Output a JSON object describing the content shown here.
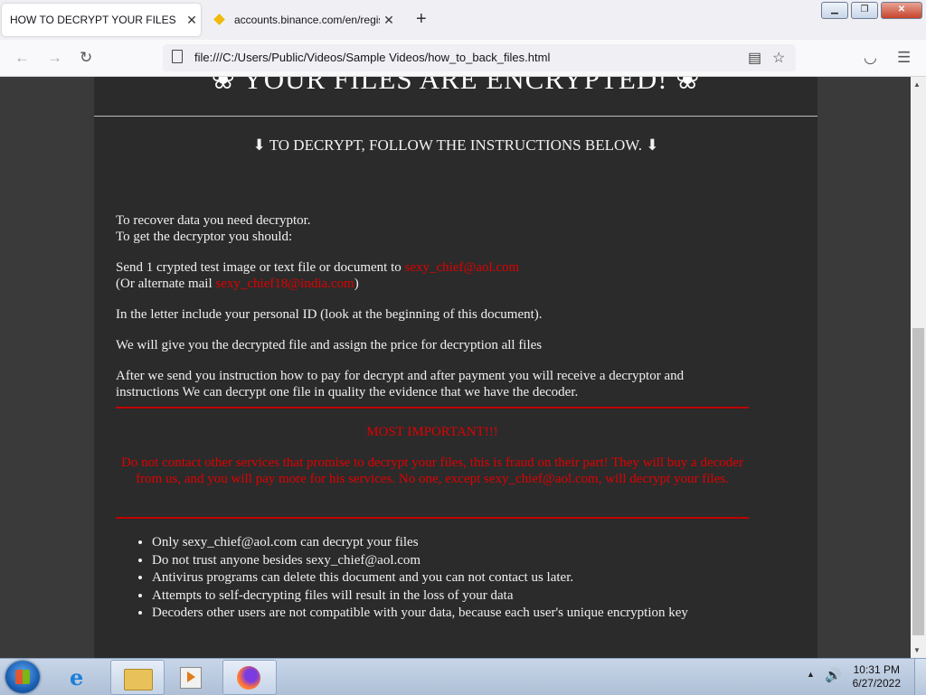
{
  "browser": {
    "tabs": [
      {
        "title": "HOW TO DECRYPT YOUR FILES",
        "active": true
      },
      {
        "title": "accounts.binance.com/en/regis",
        "active": false
      }
    ],
    "url": "file:///C:/Users/Public/Videos/Sample Videos/how_to_back_files.html"
  },
  "page": {
    "heading": "❀ YOUR FILES ARE ENCRYPTED! ❀",
    "subheading": "⬇ TO DECRYPT, FOLLOW THE INSTRUCTIONS BELOW. ⬇",
    "p1_line1": "To recover data you need decryptor.",
    "p1_line2": "To get the decryptor you should:",
    "p2_text": "Send 1 crypted test image or text file or document to ",
    "p2_email": "sexy_chief@aol.com",
    "p2_alt_prefix": "(Or alternate mail ",
    "p2_alt_email": "sexy_chief18@india.com",
    "p2_alt_suffix": ")",
    "p3": "In the letter include your personal ID (look at the beginning of this document).",
    "p4": "We will give you the decrypted file and assign the price for decryption all files",
    "p5": "After we send you instruction how to pay for decrypt and after payment you will receive a decryptor and instructions We can decrypt one file in quality the evidence that we have the decoder.",
    "important_title": "MOST IMPORTANT!!!",
    "important_text": "Do not contact other services that promise to decrypt your files, this is fraud on their part! They will buy a decoder from us, and you will pay more for his services. No one, except sexy_chief@aol.com, will decrypt your files.",
    "bullets": [
      "Only sexy_chief@aol.com can decrypt your files",
      "Do not trust anyone besides sexy_chief@aol.com",
      "Antivirus programs can delete this document and you can not contact us later.",
      "Attempts to self-decrypting files will result in the loss of your data",
      "Decoders other users are not compatible with your data, because each user's unique encryption key"
    ]
  },
  "taskbar": {
    "time": "10:31 PM",
    "date": "6/27/2022"
  },
  "colors": {
    "accent_red": "#e00000",
    "panel_bg": "#2b2b2b"
  }
}
